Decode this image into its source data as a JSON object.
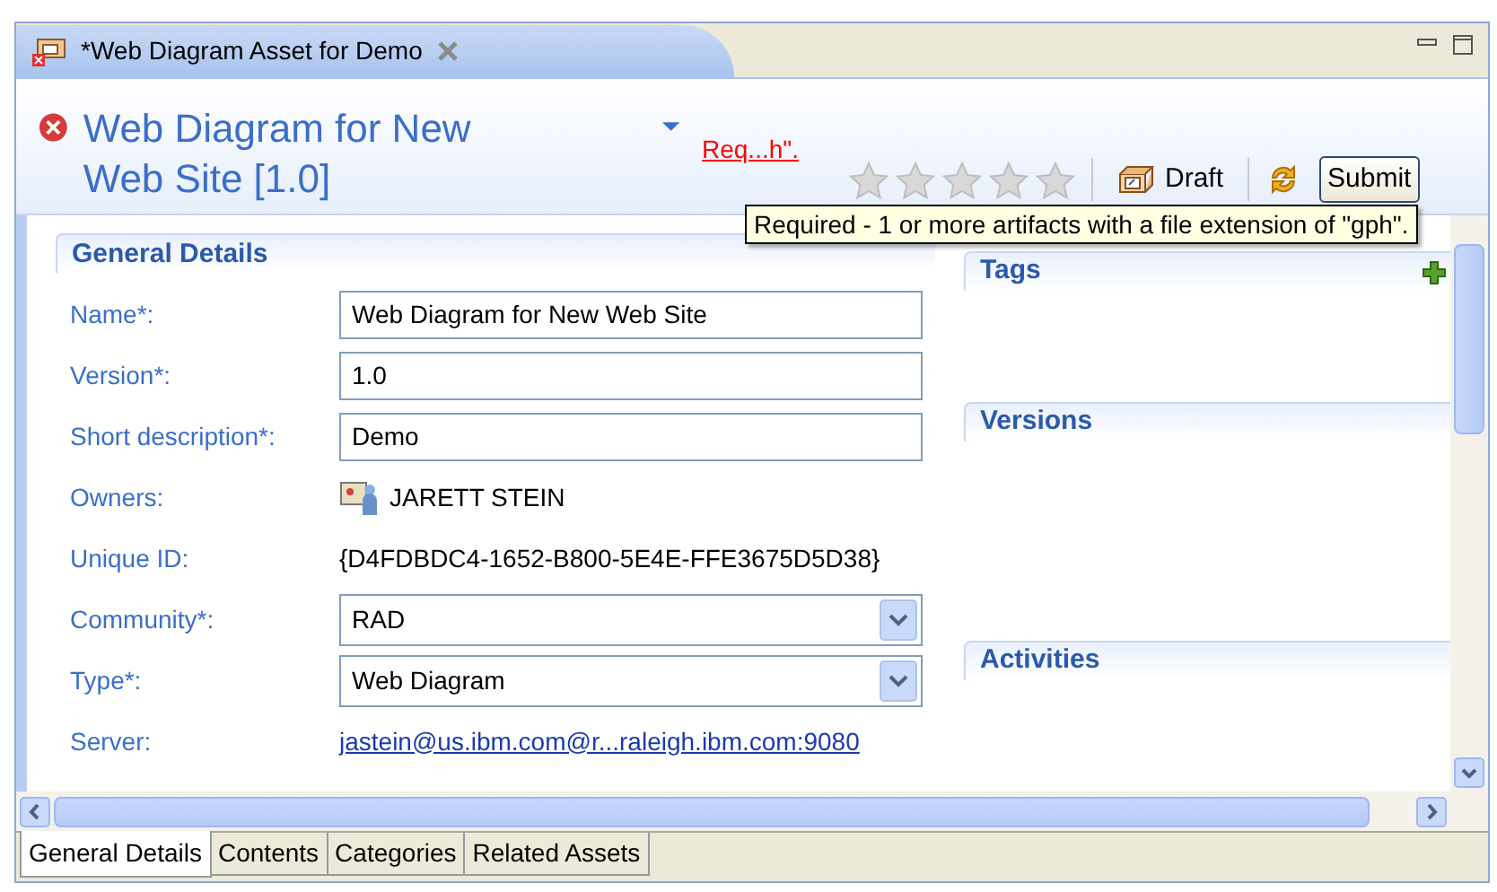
{
  "editor_tab": {
    "title": "*Web Diagram Asset for Demo"
  },
  "header": {
    "title": "Web Diagram for New Web Site [1.0]",
    "link": "Req...h\".",
    "rating": {
      "stars": 0
    },
    "buttons": [
      {
        "kind": "draft",
        "label": "Draft"
      },
      {
        "kind": "submit",
        "label": "Submit"
      }
    ],
    "tooltip": "Required - 1 or more artifacts with a file extension of \"gph\"."
  },
  "general_details": {
    "title": "General Details",
    "fields": [
      {
        "kind": "text",
        "label": "Name*:",
        "value": "Web Diagram for New Web Site"
      },
      {
        "kind": "text",
        "label": "Version*:",
        "value": "1.0"
      },
      {
        "kind": "text",
        "label": "Short description*:",
        "value": "Demo"
      },
      {
        "kind": "person",
        "label": "Owners:",
        "value": "JARETT STEIN"
      },
      {
        "kind": "plain",
        "label": "Unique ID:",
        "value": "{D4FDBDC4-1652-B800-5E4E-FFE3675D5D38}"
      },
      {
        "kind": "select",
        "label": "Community*:",
        "value": "RAD"
      },
      {
        "kind": "select",
        "label": "Type*:",
        "value": "Web Diagram"
      },
      {
        "kind": "link",
        "label": "Server:",
        "value": "jastein@us.ibm.com@r...raleigh.ibm.com:9080"
      }
    ]
  },
  "side_sections": [
    {
      "kind": "addable",
      "title": "Tags"
    },
    {
      "kind": "plain",
      "title": "Versions"
    },
    {
      "kind": "plain",
      "title": "Activities"
    }
  ],
  "bottom_tabs": [
    {
      "label": "General Details",
      "selected": true
    },
    {
      "label": "Contents",
      "selected": false
    },
    {
      "label": "Categories",
      "selected": false
    },
    {
      "label": "Related Assets",
      "selected": false
    }
  ]
}
